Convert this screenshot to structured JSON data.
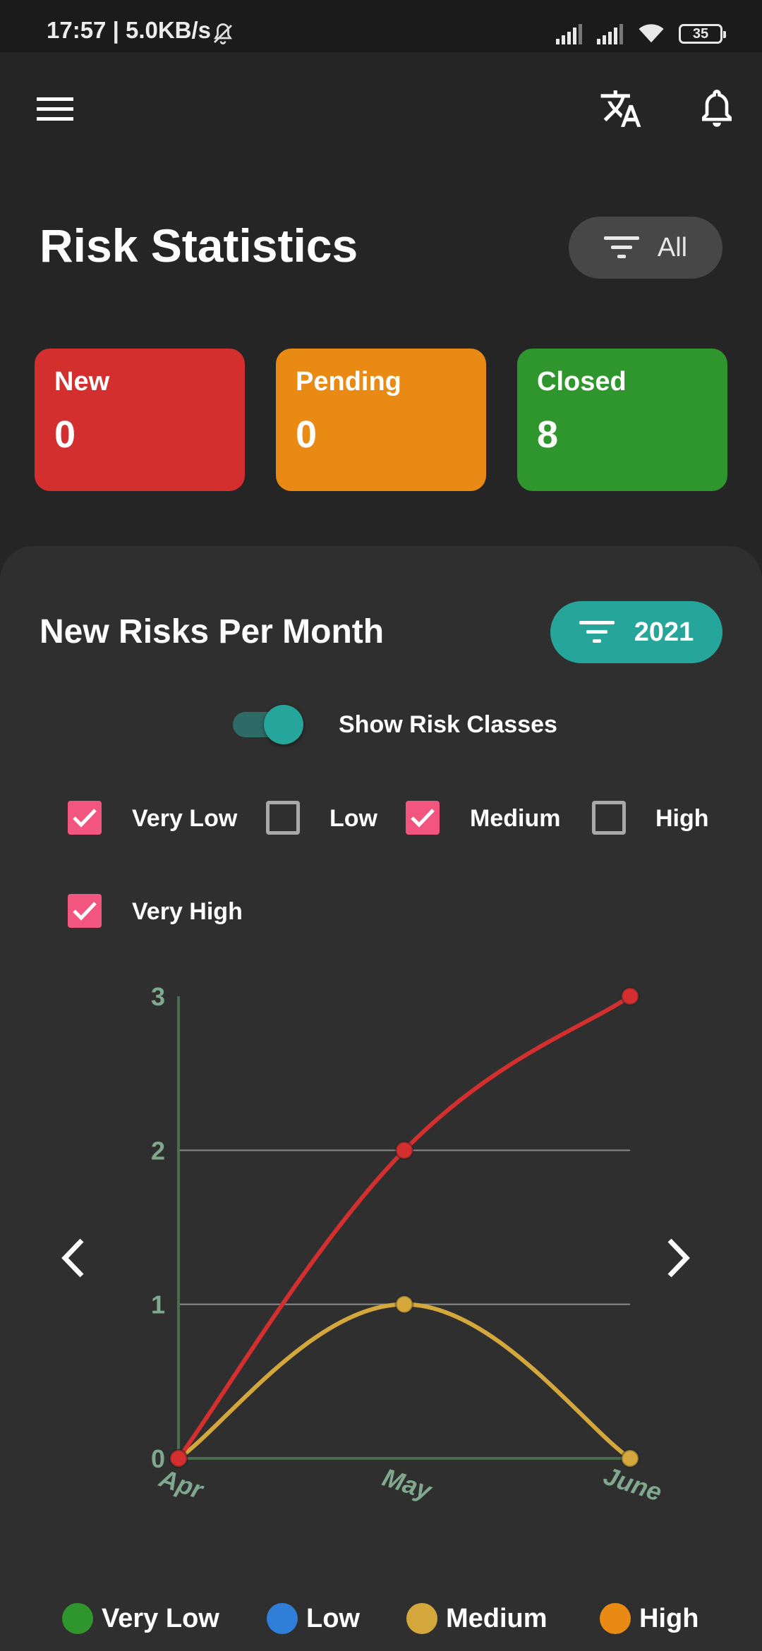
{
  "status_bar": {
    "time": "17:57 | 5.0KB/s",
    "battery": "35"
  },
  "header": {
    "menu_icon": "hamburger-menu-icon",
    "translate_icon": "translate-icon",
    "notification_icon": "bell-icon"
  },
  "page": {
    "title": "Risk Statistics",
    "filter_label": "All"
  },
  "stats": [
    {
      "label": "New",
      "value": "0",
      "color": "#d32f2f"
    },
    {
      "label": "Pending",
      "value": "0",
      "color": "#e88a14"
    },
    {
      "label": "Closed",
      "value": "8",
      "color": "#2e962c"
    }
  ],
  "risk_chart_section": {
    "title": "New Risks Per Month",
    "year": "2021",
    "toggle_label": "Show Risk Classes",
    "toggle_on": true,
    "filters": [
      {
        "label": "Very Low",
        "checked": true
      },
      {
        "label": "Low",
        "checked": false
      },
      {
        "label": "Medium",
        "checked": true
      },
      {
        "label": "High",
        "checked": false
      },
      {
        "label": "Very High",
        "checked": true
      }
    ]
  },
  "legend": [
    {
      "label": "Very Low",
      "color": "#2e962c"
    },
    {
      "label": "Low",
      "color": "#2f7fd9"
    },
    {
      "label": "Medium",
      "color": "#d4a73c"
    },
    {
      "label": "High",
      "color": "#e88a14"
    }
  ],
  "chart_data": {
    "type": "line",
    "x": [
      "Apr",
      "May",
      "June"
    ],
    "ylim": [
      0,
      3
    ],
    "yticks": [
      "0",
      "1",
      "2",
      "3"
    ],
    "grid": true,
    "series": [
      {
        "color": "#d32f2f",
        "values": [
          0,
          2,
          3
        ]
      },
      {
        "color": "#d4a73c",
        "values": [
          0,
          1,
          0
        ]
      }
    ]
  }
}
